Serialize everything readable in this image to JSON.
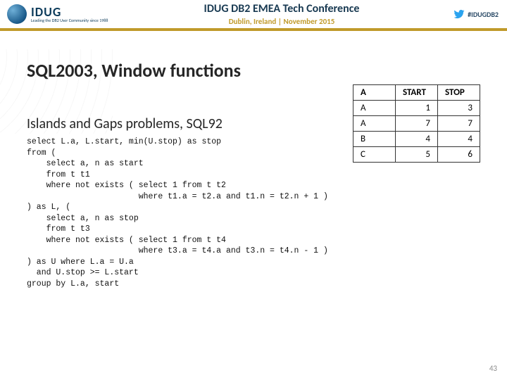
{
  "header": {
    "logo_main": "IDUG",
    "logo_sub": "Leading the DB2 User Community since 1988",
    "conf_title": "IDUG DB2 EMEA Tech Conference",
    "conf_sub": "Dublin, Ireland | November 2015",
    "hashtag": "#IDUGDB2"
  },
  "title": "SQL2003, Window functions",
  "subtitle": "Islands and Gaps problems, SQL92",
  "table": {
    "head": {
      "c0": "A",
      "c1": "START",
      "c2": "STOP"
    },
    "rows": [
      {
        "c0": "A",
        "c1": "1",
        "c2": "3"
      },
      {
        "c0": "A",
        "c1": "7",
        "c2": "7"
      },
      {
        "c0": "B",
        "c1": "4",
        "c2": "4"
      },
      {
        "c0": "C",
        "c1": "5",
        "c2": "6"
      }
    ]
  },
  "code": "select L.a, L.start, min(U.stop) as stop\nfrom (\n    select a, n as start\n    from t t1\n    where not exists ( select 1 from t t2\n                       where t1.a = t2.a and t1.n = t2.n + 1 )\n) as L, (\n    select a, n as stop\n    from t t3\n    where not exists ( select 1 from t t4\n                       where t3.a = t4.a and t3.n = t4.n - 1 )\n) as U where L.a = U.a\n  and U.stop >= L.start\ngroup by L.a, start",
  "page_number": "43",
  "icons": {
    "twitter": "twitter-bird-icon"
  }
}
